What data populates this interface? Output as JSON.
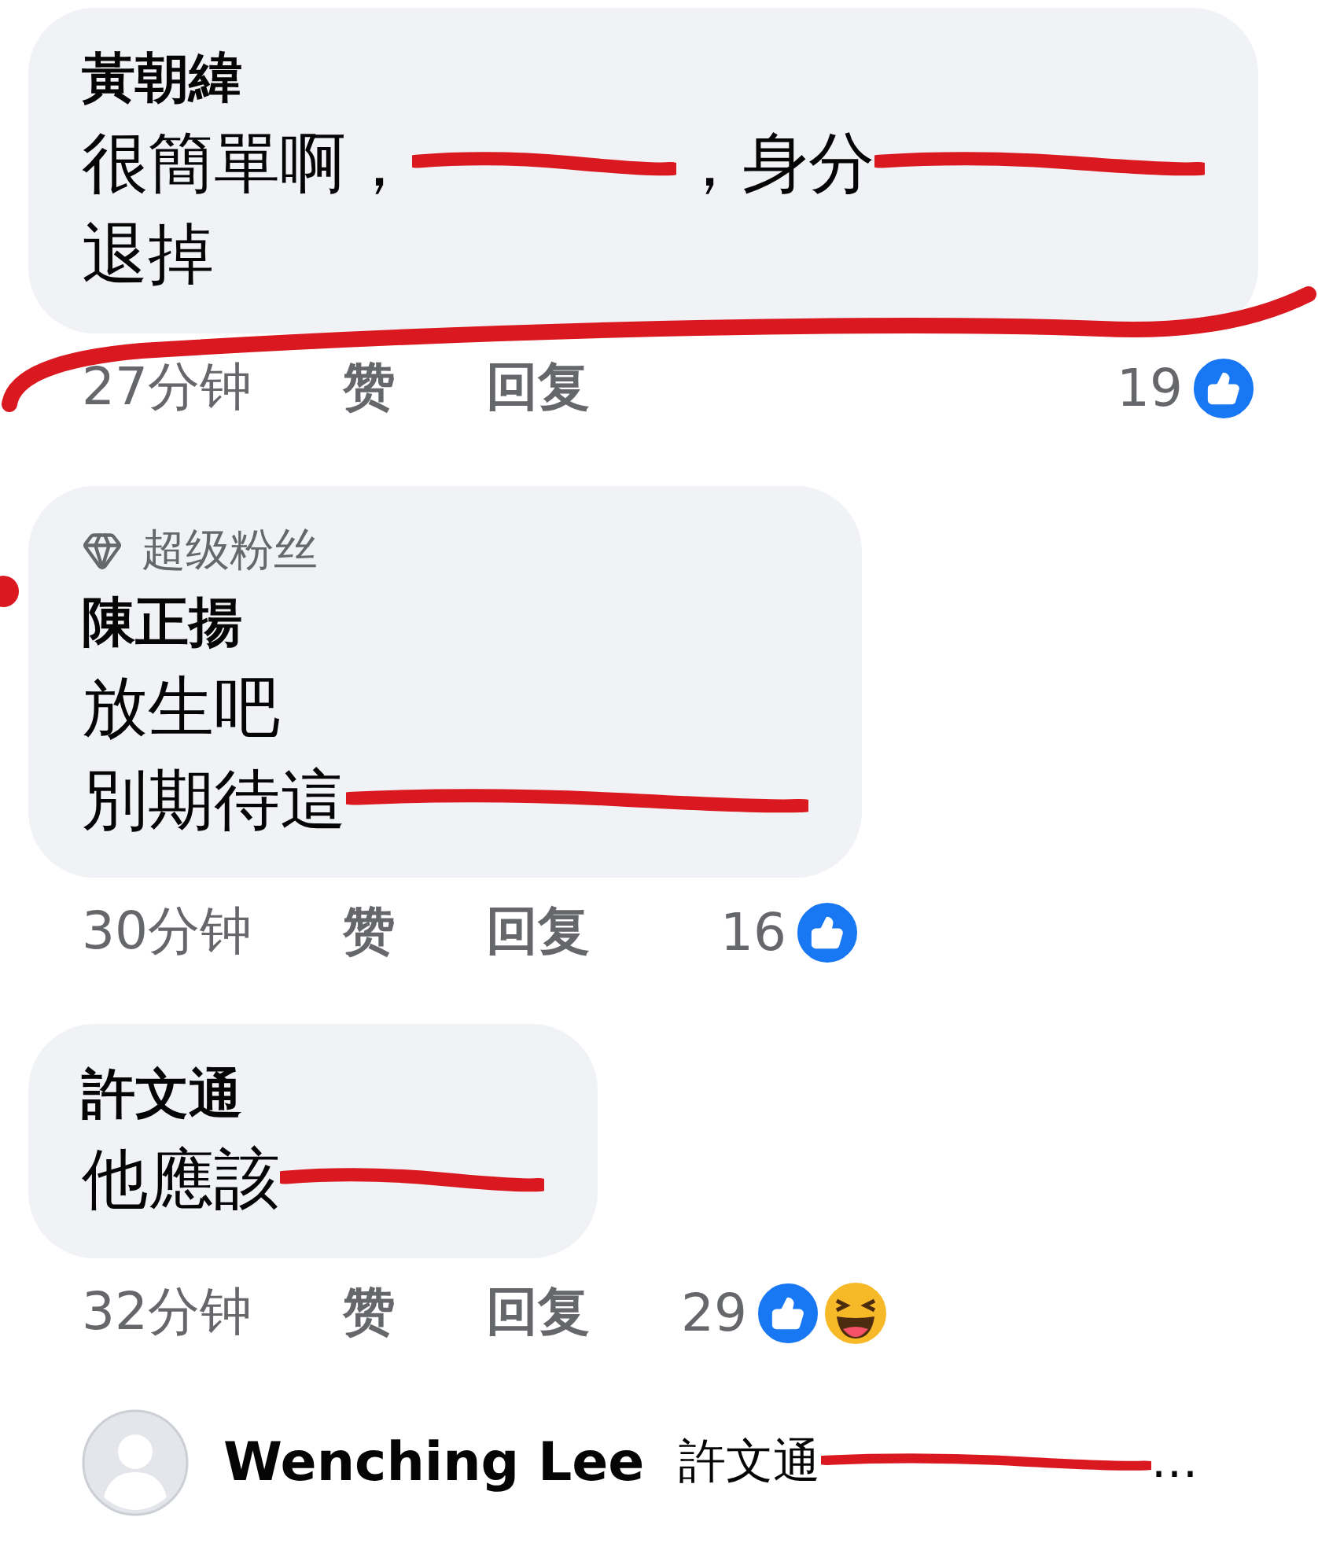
{
  "comments": [
    {
      "author": "黃朝緯",
      "lines": [
        [
          {
            "kind": "text",
            "text": "很簡單啊，"
          },
          {
            "kind": "scribble_short"
          },
          {
            "kind": "text",
            "text": "，身分"
          },
          {
            "kind": "scribble_medium"
          }
        ],
        [
          {
            "kind": "text",
            "text": "退掉"
          }
        ]
      ],
      "underline_scribble": true,
      "time": "27分钟",
      "like": "赞",
      "reply": "回复",
      "count": "19",
      "reactions": [
        {
          "kind": "like"
        }
      ]
    },
    {
      "badge": "超级粉丝",
      "author": "陳正揚",
      "lines": [
        [
          {
            "kind": "text",
            "text": "放生吧"
          }
        ],
        [
          {
            "kind": "text",
            "text": "別期待這"
          },
          {
            "kind": "scribble_long"
          }
        ]
      ],
      "time": "30分钟",
      "like": "赞",
      "reply": "回复",
      "count": "16",
      "reactions": [
        {
          "kind": "like"
        }
      ]
    },
    {
      "author": "許文通",
      "lines": [
        [
          {
            "kind": "text",
            "text": "他應該"
          },
          {
            "kind": "scribble_short"
          }
        ]
      ],
      "time": "32分钟",
      "like": "赞",
      "reply": "回复",
      "count": "29",
      "reactions": [
        {
          "kind": "like"
        },
        {
          "kind": "haha"
        }
      ]
    }
  ],
  "reply_preview": {
    "author": "Wenching Lee",
    "segments": [
      {
        "kind": "text",
        "text": "許文通"
      },
      {
        "kind": "scribble_long"
      },
      {
        "kind": "text",
        "text": "…"
      }
    ]
  }
}
